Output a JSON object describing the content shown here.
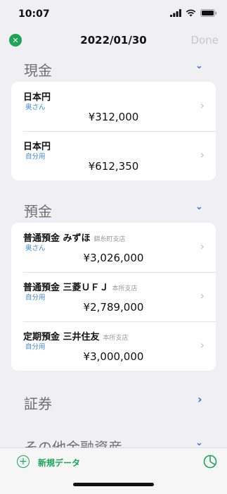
{
  "status_bar": {
    "time": "10:07"
  },
  "nav": {
    "title": "2022/01/30",
    "done_label": "Done"
  },
  "sections": [
    {
      "header": "現金",
      "rows": [
        {
          "name": "日本円",
          "branch": "",
          "owner": "奥さん",
          "amount": "¥312,000"
        },
        {
          "name": "日本円",
          "branch": "",
          "owner": "自分用",
          "amount": "¥612,350"
        }
      ]
    },
    {
      "header": "預金",
      "rows": [
        {
          "name": "普通預金 みずほ",
          "branch": "錦糸町支店",
          "owner": "奥さん",
          "amount": "¥3,026,000"
        },
        {
          "name": "普通預金 三菱ＵＦＪ",
          "branch": "本所支店",
          "owner": "自分用",
          "amount": "¥2,789,000"
        },
        {
          "name": "定期預金 三井住友",
          "branch": "本所支店",
          "owner": "自分用",
          "amount": "¥3,000,000"
        }
      ]
    },
    {
      "header": "証券",
      "rows": []
    },
    {
      "header": "その他金融資産",
      "rows": []
    }
  ],
  "toolbar": {
    "add_label": "新規データ"
  },
  "icons": {
    "close": "close-icon",
    "chevron_down": "chevron-down-icon",
    "chevron_right": "chevron-right-icon",
    "add": "plus-circle-icon",
    "chart": "pie-chart-icon"
  },
  "colors": {
    "accent_green": "#1aa557",
    "link_blue": "#3b88dd",
    "background": "#efeff4"
  }
}
